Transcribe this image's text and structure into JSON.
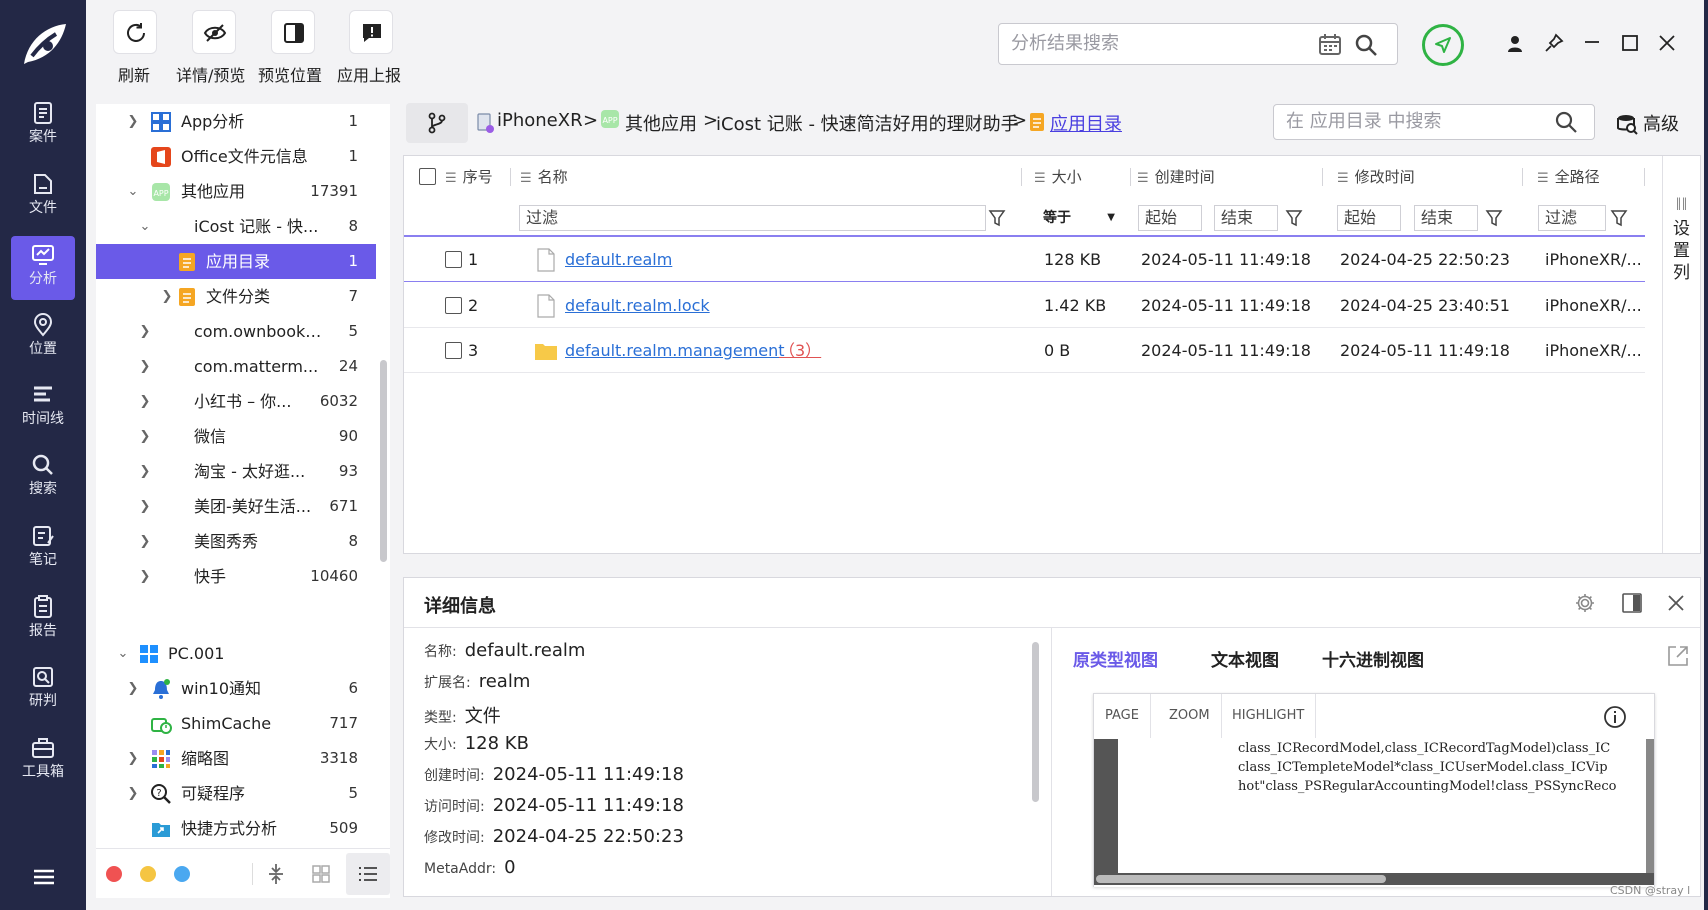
{
  "rail": {
    "items": [
      {
        "label": "案件",
        "icon": "case-icon"
      },
      {
        "label": "文件",
        "icon": "file-icon"
      },
      {
        "label": "分析",
        "icon": "analysis-icon",
        "active": true
      },
      {
        "label": "位置",
        "icon": "location-icon"
      },
      {
        "label": "时间线",
        "icon": "timeline-icon"
      },
      {
        "label": "搜索",
        "icon": "search-icon"
      },
      {
        "label": "笔记",
        "icon": "note-icon"
      },
      {
        "label": "报告",
        "icon": "report-icon"
      },
      {
        "label": "研判",
        "icon": "judge-icon"
      },
      {
        "label": "工具箱",
        "icon": "toolbox-icon"
      }
    ]
  },
  "toolbar": {
    "refresh": "刷新",
    "detail_preview": "详情/预览",
    "preview_position": "预览位置",
    "report_app": "应用上报"
  },
  "top_search": {
    "placeholder": "分析结果搜索"
  },
  "tree": {
    "items": [
      {
        "name": "App分析",
        "count": "1"
      },
      {
        "name": "Office文件元信息",
        "count": "1"
      },
      {
        "name": "其他应用",
        "count": "17391"
      },
      {
        "name": "iCost 记账 - 快...",
        "count": "8"
      },
      {
        "name": "应用目录",
        "count": "1"
      },
      {
        "name": "文件分类",
        "count": "7"
      },
      {
        "name": "com.ownbook....",
        "count": "5"
      },
      {
        "name": "com.matterm...",
        "count": "24"
      },
      {
        "name": "小红书 – 你...",
        "count": "6032"
      },
      {
        "name": "微信",
        "count": "90"
      },
      {
        "name": "淘宝 - 太好逛...",
        "count": "93"
      },
      {
        "name": "美团-美好生活...",
        "count": "671"
      },
      {
        "name": "美图秀秀",
        "count": "8"
      },
      {
        "name": "快手",
        "count": "10460"
      },
      {
        "name": "PC.001",
        "count": ""
      },
      {
        "name": "win10通知",
        "count": "6"
      },
      {
        "name": "ShimCache",
        "count": "717"
      },
      {
        "name": "缩略图",
        "count": "3318"
      },
      {
        "name": "可疑程序",
        "count": "5"
      },
      {
        "name": "快捷方式分析",
        "count": "509"
      }
    ]
  },
  "breadcrumb": {
    "device": "iPhoneXR",
    "app_group": "其他应用",
    "app": "iCost 记账 - 快速简洁好用的理财助手",
    "current": "应用目录",
    "sep": ">"
  },
  "dir_search": {
    "placeholder": "在 应用目录 中搜索"
  },
  "advanced": "高级",
  "table": {
    "headers": {
      "index": "序号",
      "name": "名称",
      "size": "大小",
      "created": "创建时间",
      "modified": "修改时间",
      "path": "全路径"
    },
    "filters": {
      "text": "过滤",
      "equals": "等于",
      "start": "起始",
      "end": "结束"
    },
    "rows": [
      {
        "index": "1",
        "name": "default.realm",
        "extra": "",
        "size": "128 KB",
        "created": "2024-05-11 11:49:18",
        "modified": "2024-04-25 22:50:23",
        "path": "iPhoneXR/...",
        "type": "file"
      },
      {
        "index": "2",
        "name": "default.realm.lock",
        "extra": "",
        "size": "1.42 KB",
        "created": "2024-05-11 11:49:18",
        "modified": "2024-04-25 23:40:51",
        "path": "iPhoneXR/...",
        "type": "file"
      },
      {
        "index": "3",
        "name": "default.realm.management",
        "extra": "（3）",
        "size": "0 B",
        "created": "2024-05-11 11:49:18",
        "modified": "2024-05-11 11:49:18",
        "path": "iPhoneXR/...",
        "type": "folder"
      }
    ],
    "settings_col": "设置列"
  },
  "detail": {
    "title": "详细信息",
    "props": [
      {
        "k": "名称:",
        "v": "default.realm"
      },
      {
        "k": "扩展名:",
        "v": "realm"
      },
      {
        "k": "类型:",
        "v": "文件"
      },
      {
        "k": "大小:",
        "v": "128 KB"
      },
      {
        "k": "创建时间:",
        "v": "2024-05-11 11:49:18"
      },
      {
        "k": "访问时间:",
        "v": "2024-05-11 11:49:18"
      },
      {
        "k": "修改时间:",
        "v": "2024-04-25 22:50:23"
      },
      {
        "k": "MetaAddr:",
        "v": "0"
      }
    ],
    "tabs": [
      "原类型视图",
      "文本视图",
      "十六进制视图"
    ],
    "viewer": {
      "buttons": [
        "PAGE",
        "ZOOM",
        "HIGHLIGHT"
      ],
      "lines": [
        "class_ICRecordModel,class_ICRecordTagModel)class_IC",
        "class_ICTempleteModel*class_ICUserModel.class_ICVip",
        "hot\"class_PSRegularAccountingModel!class_PSSyncReco"
      ]
    }
  },
  "watermark": "CSDN @stray l",
  "colors": {
    "accent": "#6a5ae8",
    "rail": "#232846",
    "link": "#2a6fd6",
    "green": "#2fb344"
  }
}
